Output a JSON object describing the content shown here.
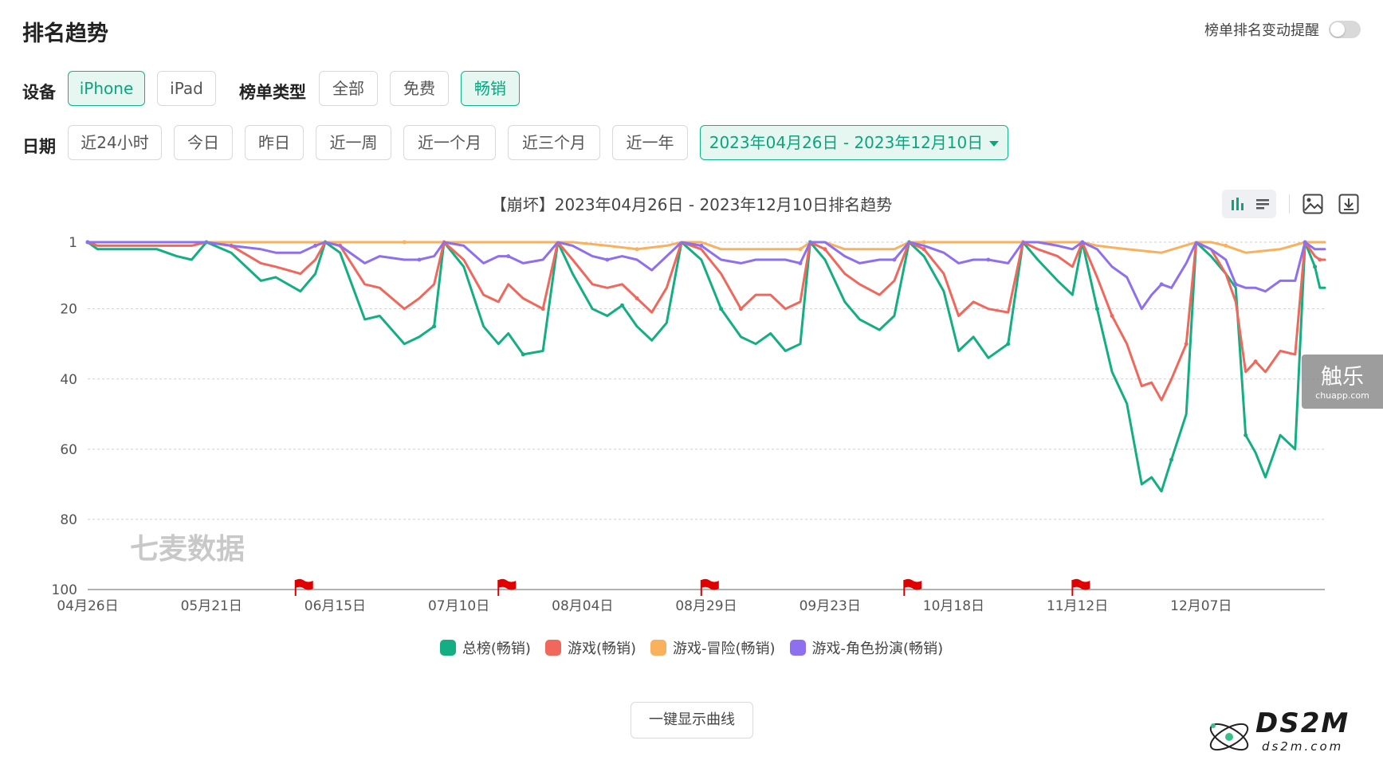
{
  "header": {
    "title": "排名趋势",
    "alert_label": "榜单排名变动提醒"
  },
  "filters": {
    "device_label": "设备",
    "devices": [
      "iPhone",
      "iPad"
    ],
    "device_selected": "iPhone",
    "chart_type_label": "榜单类型",
    "chart_types": [
      "全部",
      "免费",
      "畅销"
    ],
    "chart_type_selected": "畅销",
    "date_label": "日期",
    "date_options": [
      "近24小时",
      "今日",
      "昨日",
      "近一周",
      "近一个月",
      "近三个月",
      "近一年"
    ],
    "date_range": "2023年04月26日 - 2023年12月10日"
  },
  "toolbar": {
    "icons": [
      "bar-chart-icon",
      "list-icon",
      "image-export-icon",
      "download-icon"
    ]
  },
  "chart_data": {
    "type": "line",
    "title": "【崩坏】2023年04月26日 - 2023年12月10日排名趋势",
    "x_tick_labels": [
      "04月26日",
      "05月21日",
      "06月15日",
      "07月10日",
      "08月04日",
      "08月29日",
      "09月23日",
      "10月18日",
      "11月12日",
      "12月07日"
    ],
    "y_tick_labels": [
      "1",
      "20",
      "40",
      "60",
      "80",
      "100"
    ],
    "y_reversed": true,
    "ylim": [
      1,
      100
    ],
    "grid": true,
    "event_flags": [
      "06月07日",
      "07月18日",
      "08月28日",
      "10月08日",
      "11月11日"
    ],
    "legend_position": "bottom",
    "series": [
      {
        "name": "总榜(畅销)",
        "color": "#13ae82",
        "points": [
          [
            "04-26",
            1
          ],
          [
            "04-28",
            3
          ],
          [
            "05-03",
            3
          ],
          [
            "05-10",
            3
          ],
          [
            "05-14",
            5
          ],
          [
            "05-17",
            6
          ],
          [
            "05-20",
            1
          ],
          [
            "05-25",
            4
          ],
          [
            "05-31",
            12
          ],
          [
            "06-03",
            11
          ],
          [
            "06-08",
            15
          ],
          [
            "06-11",
            10
          ],
          [
            "06-13",
            1
          ],
          [
            "06-16",
            4
          ],
          [
            "06-21",
            23
          ],
          [
            "06-24",
            22
          ],
          [
            "06-29",
            30
          ],
          [
            "07-02",
            28
          ],
          [
            "07-05",
            25
          ],
          [
            "07-07",
            1
          ],
          [
            "07-11",
            8
          ],
          [
            "07-15",
            25
          ],
          [
            "07-18",
            30
          ],
          [
            "07-20",
            27
          ],
          [
            "07-23",
            33
          ],
          [
            "07-27",
            32
          ],
          [
            "07-30",
            1
          ],
          [
            "08-02",
            10
          ],
          [
            "08-06",
            20
          ],
          [
            "08-09",
            22
          ],
          [
            "08-12",
            19
          ],
          [
            "08-15",
            25
          ],
          [
            "08-18",
            29
          ],
          [
            "08-21",
            24
          ],
          [
            "08-24",
            1
          ],
          [
            "08-28",
            6
          ],
          [
            "09-01",
            20
          ],
          [
            "09-05",
            28
          ],
          [
            "09-08",
            30
          ],
          [
            "09-11",
            27
          ],
          [
            "09-14",
            32
          ],
          [
            "09-17",
            30
          ],
          [
            "09-19",
            1
          ],
          [
            "09-22",
            6
          ],
          [
            "09-26",
            18
          ],
          [
            "09-29",
            23
          ],
          [
            "10-03",
            26
          ],
          [
            "10-06",
            22
          ],
          [
            "10-09",
            1
          ],
          [
            "10-12",
            5
          ],
          [
            "10-16",
            15
          ],
          [
            "10-19",
            32
          ],
          [
            "10-22",
            28
          ],
          [
            "10-25",
            34
          ],
          [
            "10-29",
            30
          ],
          [
            "11-01",
            1
          ],
          [
            "11-04",
            6
          ],
          [
            "11-08",
            12
          ],
          [
            "11-11",
            16
          ],
          [
            "11-13",
            1
          ],
          [
            "11-16",
            20
          ],
          [
            "11-19",
            38
          ],
          [
            "11-22",
            47
          ],
          [
            "11-25",
            70
          ],
          [
            "11-27",
            68
          ],
          [
            "11-29",
            72
          ],
          [
            "12-01",
            63
          ],
          [
            "12-04",
            50
          ],
          [
            "12-06",
            1
          ],
          [
            "12-09",
            5
          ],
          [
            "12-12",
            10
          ],
          [
            "12-14",
            14
          ],
          [
            "12-16",
            56
          ],
          [
            "12-18",
            61
          ],
          [
            "12-20",
            68
          ],
          [
            "12-23",
            56
          ],
          [
            "12-26",
            60
          ],
          [
            "12-28",
            1
          ],
          [
            "12-30",
            8
          ],
          [
            "12-31",
            14
          ],
          [
            "01-01",
            14
          ]
        ]
      },
      {
        "name": "游戏(畅销)",
        "color": "#f0675c",
        "points": [
          [
            "04-26",
            1
          ],
          [
            "04-28",
            2
          ],
          [
            "05-10",
            2
          ],
          [
            "05-14",
            2
          ],
          [
            "05-17",
            2
          ],
          [
            "05-20",
            1
          ],
          [
            "05-25",
            2
          ],
          [
            "05-31",
            7
          ],
          [
            "06-03",
            8
          ],
          [
            "06-08",
            10
          ],
          [
            "06-11",
            6
          ],
          [
            "06-13",
            1
          ],
          [
            "06-16",
            2
          ],
          [
            "06-21",
            13
          ],
          [
            "06-24",
            14
          ],
          [
            "06-29",
            20
          ],
          [
            "07-02",
            17
          ],
          [
            "07-05",
            13
          ],
          [
            "07-07",
            1
          ],
          [
            "07-11",
            6
          ],
          [
            "07-15",
            16
          ],
          [
            "07-18",
            18
          ],
          [
            "07-20",
            13
          ],
          [
            "07-23",
            17
          ],
          [
            "07-27",
            20
          ],
          [
            "07-30",
            1
          ],
          [
            "08-02",
            6
          ],
          [
            "08-06",
            13
          ],
          [
            "08-09",
            14
          ],
          [
            "08-12",
            13
          ],
          [
            "08-15",
            17
          ],
          [
            "08-18",
            21
          ],
          [
            "08-21",
            14
          ],
          [
            "08-24",
            1
          ],
          [
            "08-28",
            3
          ],
          [
            "09-01",
            10
          ],
          [
            "09-05",
            20
          ],
          [
            "09-08",
            16
          ],
          [
            "09-11",
            16
          ],
          [
            "09-14",
            20
          ],
          [
            "09-17",
            18
          ],
          [
            "09-19",
            1
          ],
          [
            "09-22",
            3
          ],
          [
            "09-26",
            10
          ],
          [
            "09-29",
            13
          ],
          [
            "10-03",
            16
          ],
          [
            "10-06",
            12
          ],
          [
            "10-09",
            1
          ],
          [
            "10-12",
            3
          ],
          [
            "10-16",
            10
          ],
          [
            "10-19",
            22
          ],
          [
            "10-22",
            18
          ],
          [
            "10-25",
            20
          ],
          [
            "10-29",
            21
          ],
          [
            "11-01",
            1
          ],
          [
            "11-04",
            3
          ],
          [
            "11-08",
            5
          ],
          [
            "11-11",
            8
          ],
          [
            "11-13",
            1
          ],
          [
            "11-16",
            11
          ],
          [
            "11-19",
            22
          ],
          [
            "11-22",
            30
          ],
          [
            "11-25",
            42
          ],
          [
            "11-27",
            41
          ],
          [
            "11-29",
            46
          ],
          [
            "12-01",
            40
          ],
          [
            "12-04",
            30
          ],
          [
            "12-06",
            1
          ],
          [
            "12-09",
            3
          ],
          [
            "12-12",
            10
          ],
          [
            "12-14",
            18
          ],
          [
            "12-16",
            38
          ],
          [
            "12-18",
            35
          ],
          [
            "12-20",
            38
          ],
          [
            "12-23",
            32
          ],
          [
            "12-26",
            33
          ],
          [
            "12-28",
            1
          ],
          [
            "12-30",
            5
          ],
          [
            "12-31",
            6
          ],
          [
            "01-01",
            6
          ]
        ]
      },
      {
        "name": "游戏-冒险(畅销)",
        "color": "#f9b15e",
        "points": [
          [
            "04-26",
            1
          ],
          [
            "05-20",
            1
          ],
          [
            "05-25",
            1
          ],
          [
            "06-08",
            1
          ],
          [
            "06-13",
            1
          ],
          [
            "06-16",
            1
          ],
          [
            "06-29",
            1
          ],
          [
            "07-07",
            1
          ],
          [
            "07-11",
            1
          ],
          [
            "07-30",
            1
          ],
          [
            "08-02",
            1
          ],
          [
            "08-09",
            2
          ],
          [
            "08-15",
            3
          ],
          [
            "08-21",
            2
          ],
          [
            "08-24",
            1
          ],
          [
            "08-28",
            1
          ],
          [
            "09-01",
            3
          ],
          [
            "09-08",
            3
          ],
          [
            "09-17",
            3
          ],
          [
            "09-19",
            1
          ],
          [
            "09-22",
            1
          ],
          [
            "09-26",
            3
          ],
          [
            "10-06",
            3
          ],
          [
            "10-09",
            1
          ],
          [
            "10-12",
            1
          ],
          [
            "10-19",
            1
          ],
          [
            "10-29",
            1
          ],
          [
            "11-01",
            1
          ],
          [
            "11-04",
            1
          ],
          [
            "11-11",
            1
          ],
          [
            "11-13",
            1
          ],
          [
            "11-16",
            2
          ],
          [
            "11-22",
            3
          ],
          [
            "11-29",
            4
          ],
          [
            "12-06",
            1
          ],
          [
            "12-09",
            1
          ],
          [
            "12-12",
            2
          ],
          [
            "12-16",
            4
          ],
          [
            "12-23",
            3
          ],
          [
            "12-28",
            1
          ],
          [
            "12-30",
            1
          ],
          [
            "01-01",
            1
          ]
        ]
      },
      {
        "name": "游戏-角色扮演(畅销)",
        "color": "#8e6ff0",
        "points": [
          [
            "04-26",
            1
          ],
          [
            "05-20",
            1
          ],
          [
            "05-25",
            2
          ],
          [
            "05-31",
            3
          ],
          [
            "06-03",
            4
          ],
          [
            "06-08",
            4
          ],
          [
            "06-11",
            2
          ],
          [
            "06-13",
            1
          ],
          [
            "06-16",
            2
          ],
          [
            "06-21",
            7
          ],
          [
            "06-24",
            5
          ],
          [
            "06-29",
            6
          ],
          [
            "07-02",
            6
          ],
          [
            "07-05",
            5
          ],
          [
            "07-07",
            1
          ],
          [
            "07-11",
            2
          ],
          [
            "07-15",
            7
          ],
          [
            "07-18",
            5
          ],
          [
            "07-20",
            5
          ],
          [
            "07-23",
            7
          ],
          [
            "07-27",
            6
          ],
          [
            "07-30",
            1
          ],
          [
            "08-02",
            2
          ],
          [
            "08-06",
            5
          ],
          [
            "08-09",
            6
          ],
          [
            "08-12",
            5
          ],
          [
            "08-15",
            6
          ],
          [
            "08-18",
            9
          ],
          [
            "08-21",
            5
          ],
          [
            "08-24",
            1
          ],
          [
            "08-28",
            2
          ],
          [
            "09-01",
            6
          ],
          [
            "09-05",
            7
          ],
          [
            "09-08",
            6
          ],
          [
            "09-11",
            6
          ],
          [
            "09-14",
            6
          ],
          [
            "09-17",
            7
          ],
          [
            "09-19",
            1
          ],
          [
            "09-22",
            1
          ],
          [
            "09-26",
            5
          ],
          [
            "09-29",
            7
          ],
          [
            "10-03",
            6
          ],
          [
            "10-06",
            6
          ],
          [
            "10-09",
            1
          ],
          [
            "10-12",
            2
          ],
          [
            "10-16",
            4
          ],
          [
            "10-19",
            7
          ],
          [
            "10-22",
            6
          ],
          [
            "10-25",
            6
          ],
          [
            "10-29",
            7
          ],
          [
            "11-01",
            1
          ],
          [
            "11-04",
            1
          ],
          [
            "11-08",
            2
          ],
          [
            "11-11",
            3
          ],
          [
            "11-13",
            1
          ],
          [
            "11-16",
            3
          ],
          [
            "11-19",
            8
          ],
          [
            "11-22",
            11
          ],
          [
            "11-25",
            20
          ],
          [
            "11-27",
            16
          ],
          [
            "11-29",
            13
          ],
          [
            "12-01",
            14
          ],
          [
            "12-04",
            7
          ],
          [
            "12-06",
            1
          ],
          [
            "12-09",
            3
          ],
          [
            "12-12",
            6
          ],
          [
            "12-14",
            13
          ],
          [
            "12-16",
            14
          ],
          [
            "12-18",
            14
          ],
          [
            "12-20",
            15
          ],
          [
            "12-23",
            12
          ],
          [
            "12-26",
            12
          ],
          [
            "12-28",
            1
          ],
          [
            "12-30",
            3
          ],
          [
            "12-31",
            3
          ],
          [
            "01-01",
            3
          ]
        ]
      }
    ]
  },
  "actions": {
    "show_curves_button": "一键显示曲线"
  },
  "watermarks": {
    "chuapp_big": "触乐",
    "chuapp_small": "chuapp.com",
    "qimai": "七麦数据",
    "ds2m_big": "DS2M",
    "ds2m_small": "ds2m.com"
  }
}
